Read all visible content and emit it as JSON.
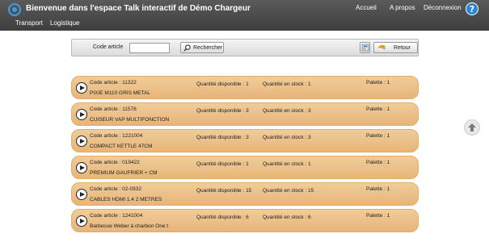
{
  "header": {
    "title": "Bienvenue dans l'espace Talk interactif de Démo Chargeur",
    "nav": [
      "Accueil",
      "A propos",
      "Déconnexion"
    ],
    "help_glyph": "?"
  },
  "subnav": [
    "Transport",
    "Logistique"
  ],
  "search": {
    "label": "Code article",
    "value": "",
    "search_button": "Rechercher",
    "back_button": "Retour"
  },
  "articles": [
    {
      "code": "Code article : 11322",
      "dispo": "Quantité disponible : 1",
      "stock": "Quantité en stock : 1",
      "palette": "Palette : 1",
      "desc": "PIXIE M110 GRIS METAL"
    },
    {
      "code": "Code article : 11578",
      "dispo": "Quantité disponible : 3",
      "stock": "Quantité en stock : 3",
      "palette": "Palette : 1",
      "desc": "CUISEUR VAP MULTIFONCTION"
    },
    {
      "code": "Code article : 1221004",
      "dispo": "Quantité disponible : 3",
      "stock": "Quantité en stock : 3",
      "palette": "Palette : 1",
      "desc": "COMPACT KETTLE 47CM"
    },
    {
      "code": "Code article : 019422",
      "dispo": "Quantité disponible : 1",
      "stock": "Quantité en stock : 1",
      "palette": "Palette : 1",
      "desc": "PREMIUM GAUFRIER + CM"
    },
    {
      "code": "Code article : 02-0932",
      "dispo": "Quantité disponible : 15",
      "stock": "Quantité en stock : 15",
      "palette": "Palette : 1",
      "desc": "CABLES HDMI 1.4  2 METRES"
    },
    {
      "code": "Code article : 1241004",
      "dispo": "Quantité disponible : 6",
      "stock": "Quantité en stock : 6",
      "palette": "Palette : 1",
      "desc": "Barbecue Weber à charbon One t"
    }
  ],
  "colors": {
    "header_bg": "#4a4a4a",
    "row_bg": "#ecc189",
    "accent": "#2d86d4"
  }
}
